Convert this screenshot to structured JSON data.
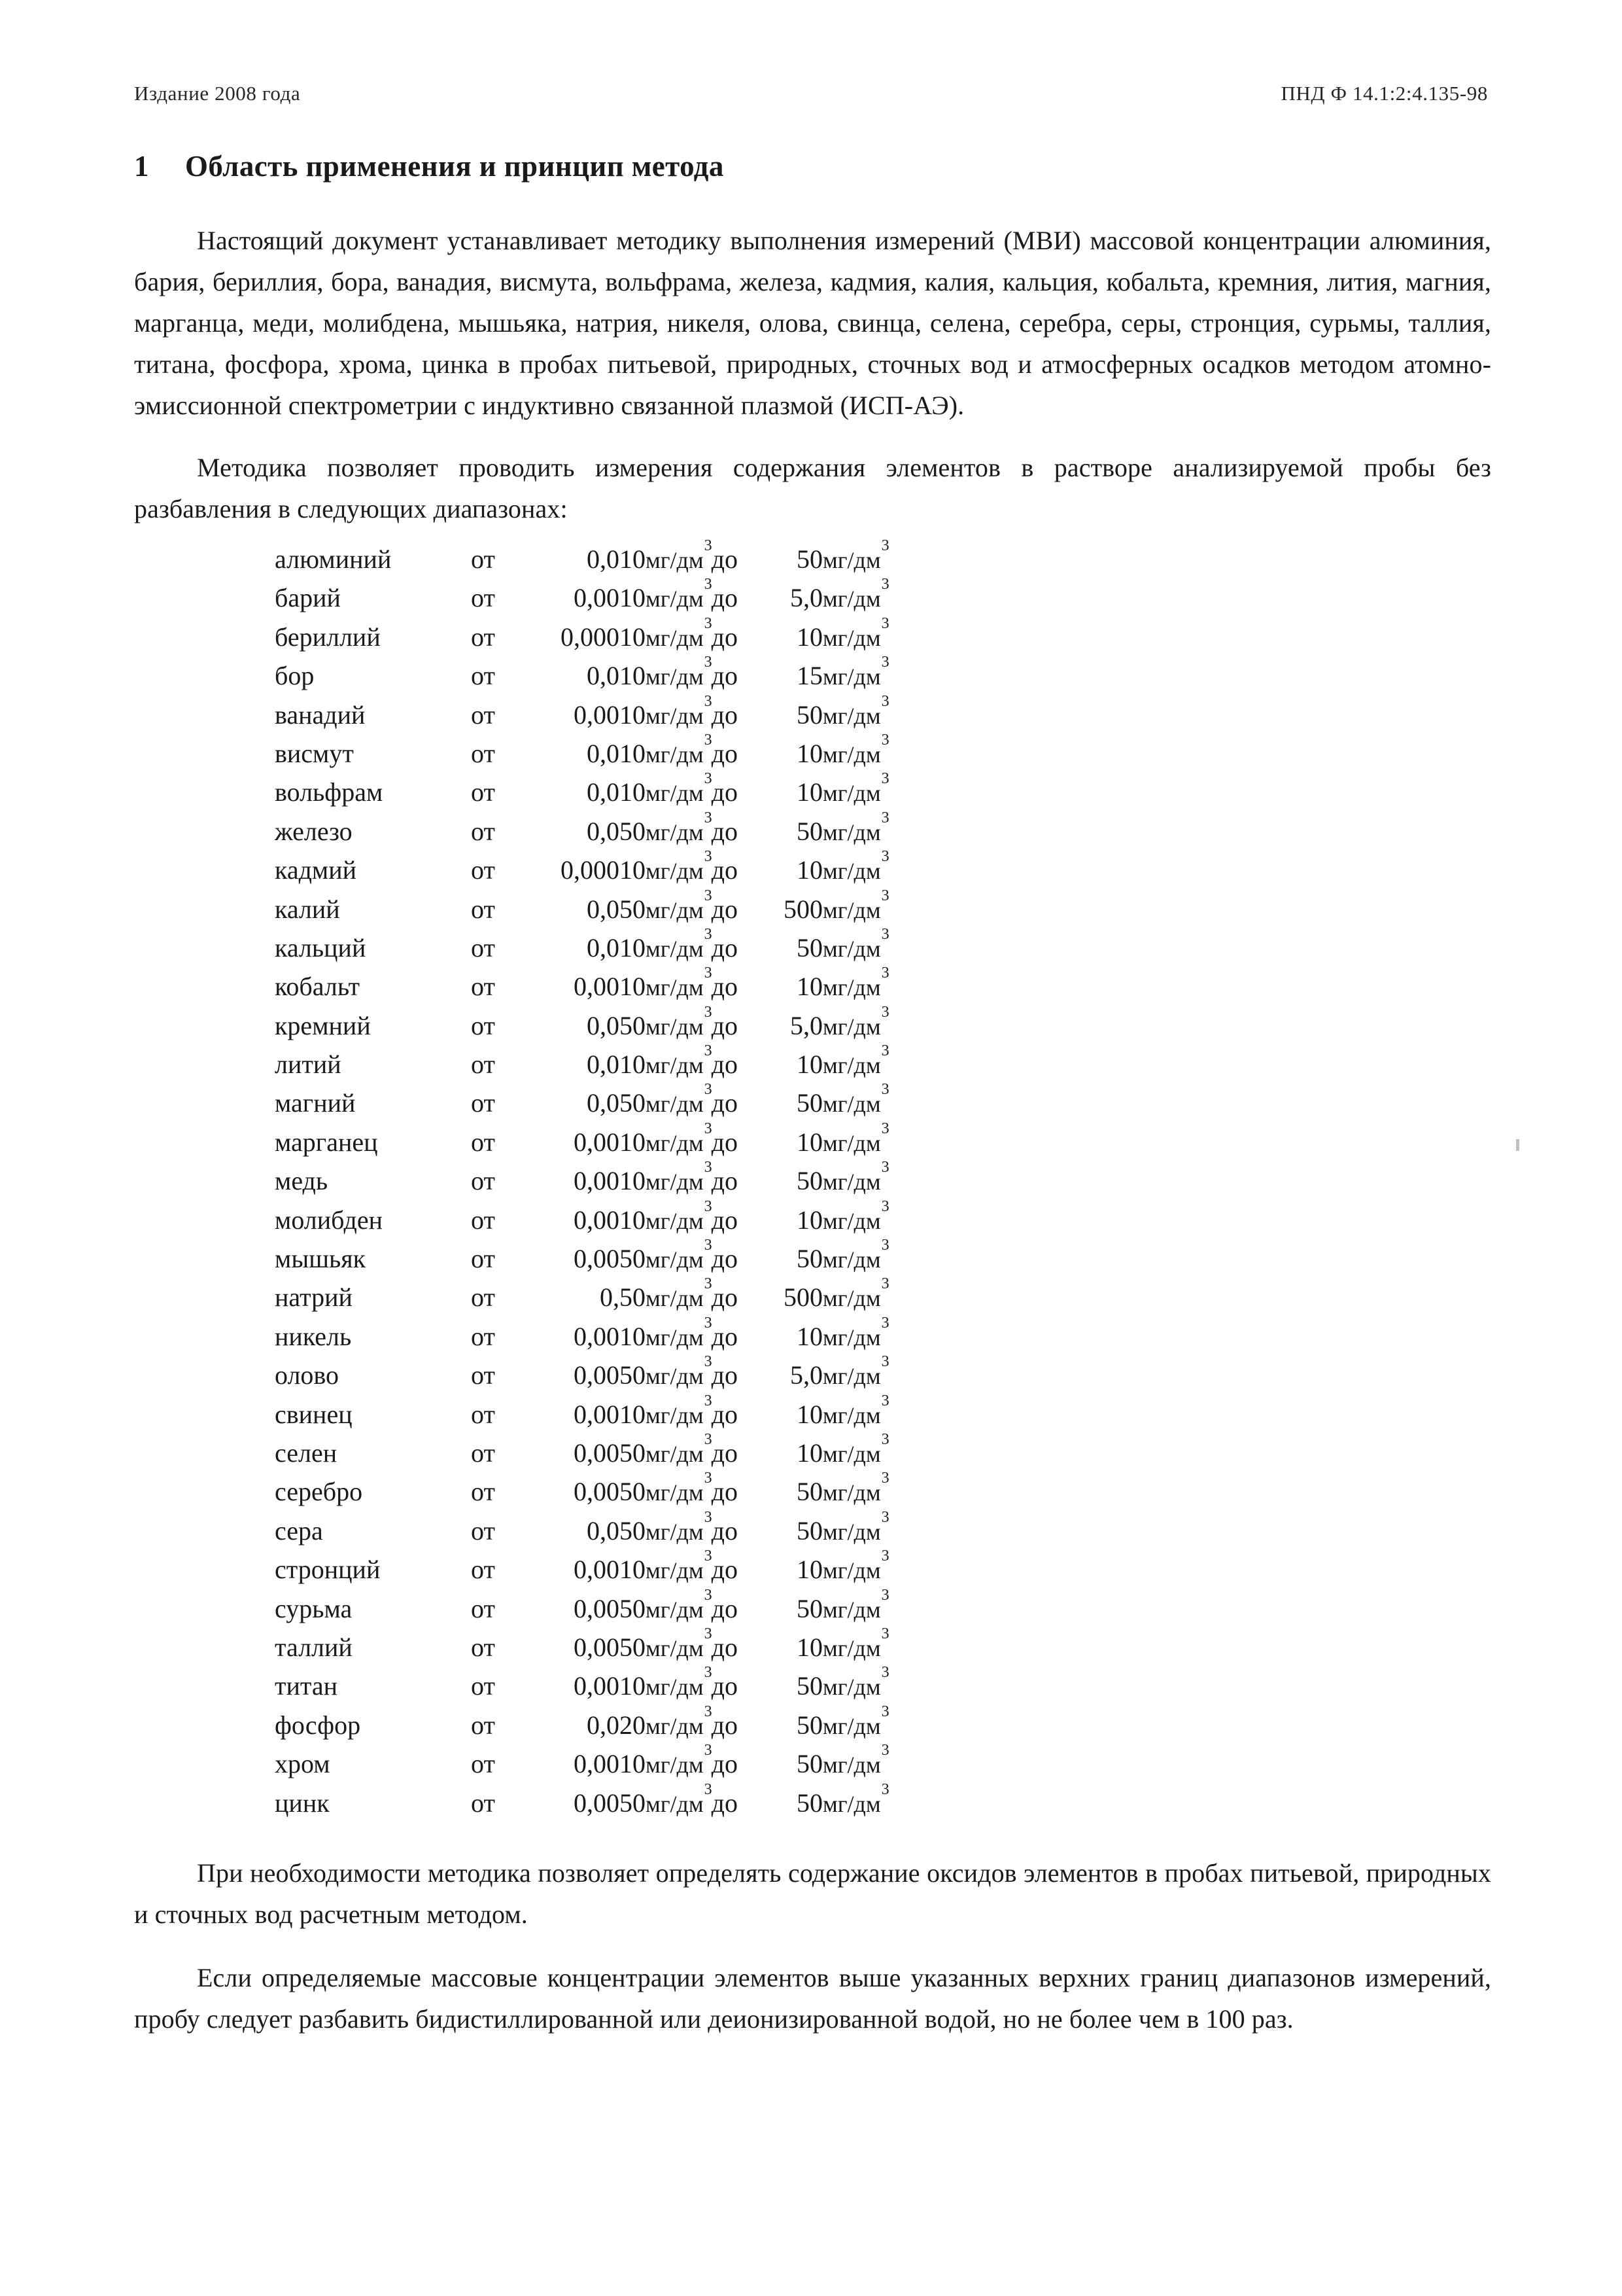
{
  "header": {
    "left": "Издание 2008 года",
    "right": "ПНД Ф 14.1:2:4.135-98"
  },
  "section": {
    "number": "1",
    "title": "Область применения и принцип метода"
  },
  "paragraphs": {
    "p1": "Настоящий документ устанавливает методику выполнения измерений (МВИ) массовой концентрации алюминия, бария, бериллия, бора, ванадия, висмута, вольфрама, железа, кадмия, калия, кальция, кобальта, кремния, лития, магния, марганца, меди, молибдена, мышьяка, натрия, никеля, олова, свинца, селена, серебра, серы, стронция, сурьмы, таллия, титана, фосфора, хрома, цинка в пробах питьевой, природных, сточных вод и атмосферных осадков методом атомно-эмиссионной спектрометрии с индуктивно связанной плазмой (ИСП-АЭ).",
    "p2": "Методика позволяет проводить измерения содержания элементов в растворе анализируемой пробы без разбавления в следующих диапазонах:",
    "p3": "При необходимости методика позволяет определять содержание оксидов элементов в пробах питьевой, природных и сточных вод расчетным методом.",
    "p4": "Если определяемые массовые концентрации элементов выше указанных верхних границ диапазонов измерений, пробу следует разбавить бидистиллированной или деионизированной водой, но не более чем в 100 раз."
  },
  "ranges_table": {
    "from_label": "от",
    "to_label": "до",
    "unit_base": "мг/дм",
    "unit_exponent": "3",
    "rows": [
      {
        "element": "алюминий",
        "low": "0,010",
        "high": "50"
      },
      {
        "element": "барий",
        "low": "0,0010",
        "high": "5,0"
      },
      {
        "element": "бериллий",
        "low": "0,00010",
        "high": "10"
      },
      {
        "element": "бор",
        "low": "0,010",
        "high": "15"
      },
      {
        "element": "ванадий",
        "low": "0,0010",
        "high": "50"
      },
      {
        "element": "висмут",
        "low": "0,010",
        "high": "10"
      },
      {
        "element": "вольфрам",
        "low": "0,010",
        "high": "10"
      },
      {
        "element": "железо",
        "low": "0,050",
        "high": "50"
      },
      {
        "element": "кадмий",
        "low": "0,00010",
        "high": "10"
      },
      {
        "element": "калий",
        "low": "0,050",
        "high": "500"
      },
      {
        "element": "кальций",
        "low": "0,010",
        "high": "50"
      },
      {
        "element": "кобальт",
        "low": "0,0010",
        "high": "10"
      },
      {
        "element": "кремний",
        "low": "0,050",
        "high": "5,0"
      },
      {
        "element": "литий",
        "low": "0,010",
        "high": "10"
      },
      {
        "element": "магний",
        "low": "0,050",
        "high": "50"
      },
      {
        "element": "марганец",
        "low": "0,0010",
        "high": "10"
      },
      {
        "element": "медь",
        "low": "0,0010",
        "high": "50"
      },
      {
        "element": "молибден",
        "low": "0,0010",
        "high": "10"
      },
      {
        "element": "мышьяк",
        "low": "0,0050",
        "high": "50"
      },
      {
        "element": "натрий",
        "low": "0,50",
        "high": "500"
      },
      {
        "element": "никель",
        "low": "0,0010",
        "high": "10"
      },
      {
        "element": "олово",
        "low": "0,0050",
        "high": "5,0"
      },
      {
        "element": "свинец",
        "low": "0,0010",
        "high": "10"
      },
      {
        "element": "селен",
        "low": "0,0050",
        "high": "10"
      },
      {
        "element": "серебро",
        "low": "0,0050",
        "high": "50"
      },
      {
        "element": "сера",
        "low": "0,050",
        "high": "50"
      },
      {
        "element": "стронций",
        "low": "0,0010",
        "high": "10"
      },
      {
        "element": "сурьма",
        "low": "0,0050",
        "high": "50"
      },
      {
        "element": "таллий",
        "low": "0,0050",
        "high": "10"
      },
      {
        "element": "титан",
        "low": "0,0010",
        "high": "50"
      },
      {
        "element": "фосфор",
        "low": "0,020",
        "high": "50"
      },
      {
        "element": "хром",
        "low": "0,0010",
        "high": "50"
      },
      {
        "element": "цинк",
        "low": "0,0050",
        "high": "50"
      }
    ]
  }
}
